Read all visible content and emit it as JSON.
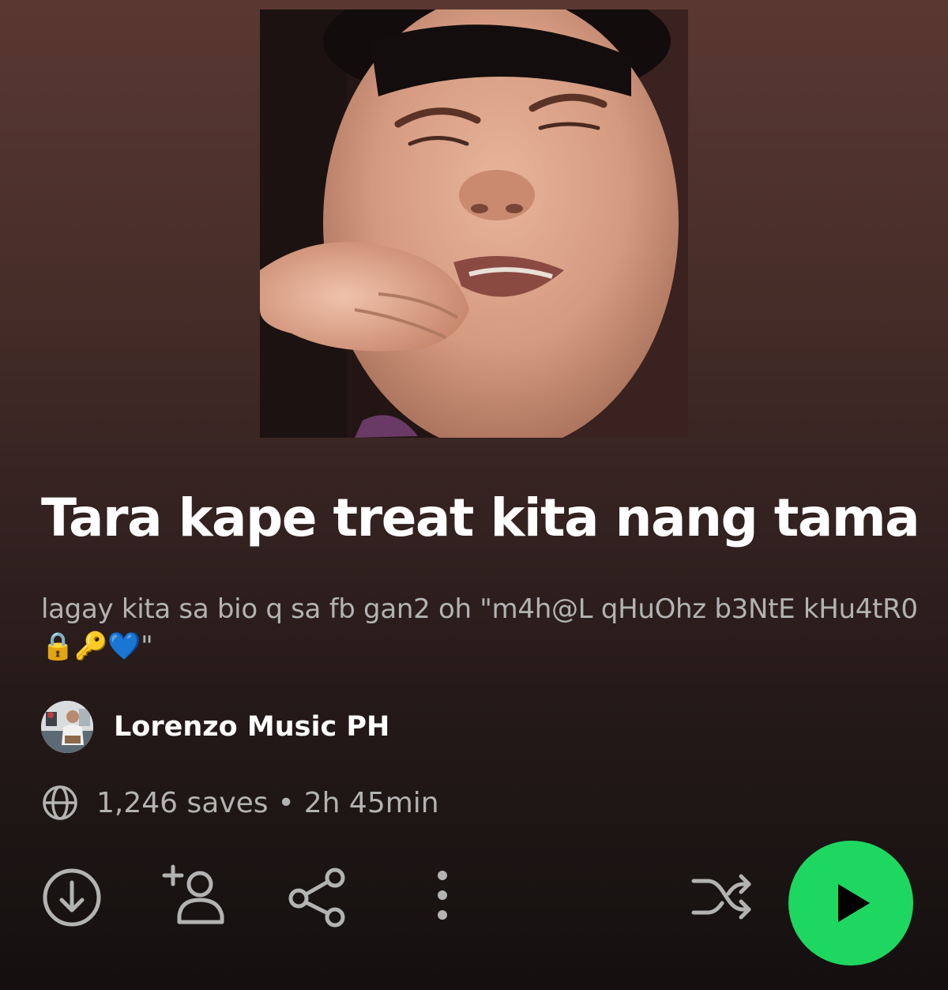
{
  "playlist": {
    "title": "Tara kape treat kita nang tama",
    "description": "lagay kita sa bio q sa fb gan2 oh \"m4h@L qHuOhz b3NtE kHu4tR0 🔒🔑💙\"",
    "owner": "Lorenzo Music PH",
    "saves": "1,246 saves",
    "separator": "•",
    "duration": "2h 45min"
  },
  "icons": {
    "visibility": "globe-icon",
    "download": "download-icon",
    "follow": "add-person-icon",
    "share": "share-icon",
    "more": "more-options-icon",
    "shuffle": "shuffle-icon",
    "play": "play-icon"
  },
  "colors": {
    "accent": "#1ed760",
    "text_primary": "#ffffff",
    "text_secondary": "#b3b3b3",
    "background_top": "#5a3832",
    "background_bottom": "#141010"
  }
}
